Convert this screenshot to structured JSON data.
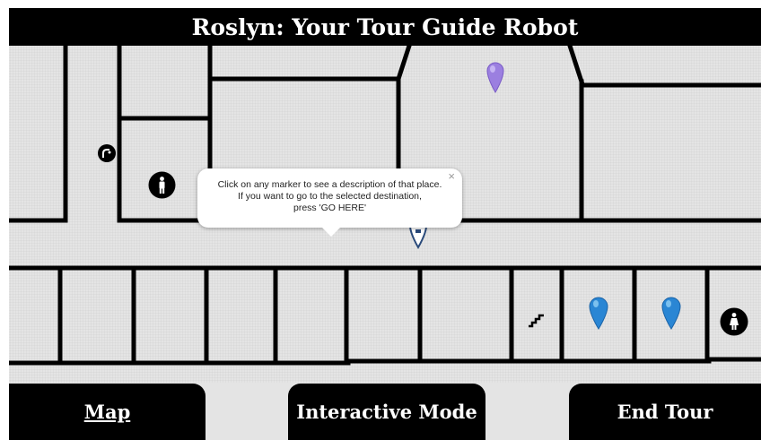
{
  "app": {
    "title": "Roslyn: Your Tour Guide Robot"
  },
  "popup": {
    "lines": [
      "Click on any marker to see a description of that place.",
      "If you want to go to the selected destination,",
      "press 'GO HERE'"
    ],
    "close_glyph": "×"
  },
  "markers": [
    {
      "icon": "purple-map-pin-icon",
      "color": "#9b7fe0"
    },
    {
      "icon": "blue-map-pin-icon",
      "color": "#2a86d4"
    },
    {
      "icon": "blue-map-pin-icon",
      "color": "#2a86d4"
    },
    {
      "icon": "partial-pin-icon",
      "color": "#2a86d4"
    }
  ],
  "map_icons": [
    {
      "icon": "drinking-fountain-icon"
    },
    {
      "icon": "mens-restroom-icon"
    },
    {
      "icon": "womens-restroom-icon"
    },
    {
      "icon": "stairs-icon"
    }
  ],
  "nav": {
    "map_label": "Map",
    "interactive_label": "Interactive Mode",
    "end_label": "End Tour"
  },
  "colors": {
    "bar": "#000000",
    "map_bg": "#e4e4e4",
    "walls": "#000000"
  }
}
